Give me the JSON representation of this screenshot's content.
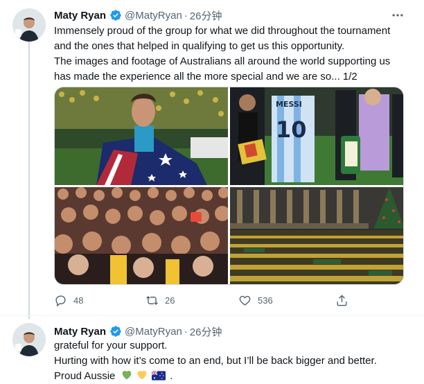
{
  "colors": {
    "verified": "#1d9bf0",
    "secondary_text": "#536471",
    "divider": "#cfd9de"
  },
  "tweets": [
    {
      "author": {
        "name": "Maty Ryan",
        "handle": "@MatyRyan",
        "verified": true
      },
      "separator": "·",
      "time": "26分钟",
      "text_lines": [
        "Immensely proud of the group for what we did throughout the tournament",
        "and the ones that helped in qualifying to get us this opportunity.",
        "The images and footage of Australians all around the world supporting us",
        "has made the experience all the more special and we are so... 1/2"
      ],
      "media": [
        {
          "alt": "player-with-australian-flag"
        },
        {
          "alt": "captains-handshake-pennant"
        },
        {
          "alt": "crowd-watching-screen"
        },
        {
          "alt": "public-square-crowd"
        }
      ],
      "actions": {
        "reply": {
          "icon": "reply-icon",
          "count": "48"
        },
        "retweet": {
          "icon": "retweet-icon",
          "count": "26"
        },
        "like": {
          "icon": "heart-icon",
          "count": "536"
        },
        "share": {
          "icon": "share-icon"
        }
      }
    },
    {
      "author": {
        "name": "Maty Ryan",
        "handle": "@MatyRyan",
        "verified": true
      },
      "separator": "·",
      "time": "26分钟",
      "text_lines": [
        "grateful for your support.",
        "Hurting with how it’s come to an end, but I’ll be back bigger and better.",
        "Proud Aussie"
      ],
      "emojis": [
        "green-heart-icon",
        "yellow-heart-icon",
        "australia-flag-icon"
      ],
      "trailing": "."
    }
  ]
}
